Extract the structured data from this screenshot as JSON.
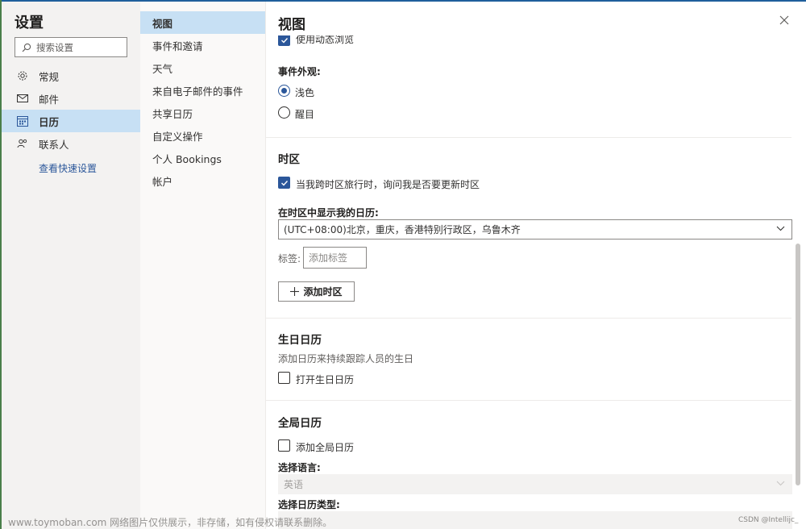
{
  "sidebar": {
    "title": "设置",
    "search_placeholder": "搜索设置",
    "items": [
      {
        "label": "常规",
        "icon": "gear-icon"
      },
      {
        "label": "邮件",
        "icon": "mail-icon"
      },
      {
        "label": "日历",
        "icon": "calendar-icon",
        "active": true
      },
      {
        "label": "联系人",
        "icon": "people-icon"
      }
    ],
    "quick_settings_link": "查看快速设置"
  },
  "subnav": {
    "items": [
      {
        "label": "视图",
        "active": true
      },
      {
        "label": "事件和邀请"
      },
      {
        "label": "天气"
      },
      {
        "label": "来自电子邮件的事件"
      },
      {
        "label": "共享日历"
      },
      {
        "label": "自定义操作"
      },
      {
        "label": "个人 Bookings"
      },
      {
        "label": "帐户"
      }
    ]
  },
  "pane": {
    "title": "视图",
    "dynamic_preview_label": "使用动态浏览",
    "event_appearance": {
      "label": "事件外观:",
      "options": [
        {
          "label": "浅色",
          "selected": true
        },
        {
          "label": "醒目",
          "selected": false
        }
      ]
    },
    "timezone": {
      "title": "时区",
      "ask_update_label": "当我跨时区旅行时，询问我是否要更新时区",
      "ask_update_checked": true,
      "display_label": "在时区中显示我的日历:",
      "selected_timezone": "(UTC+08:00)北京，重庆，香港特别行政区，乌鲁木齐",
      "tag_label": "标签:",
      "tag_placeholder": "添加标签",
      "add_button": "添加时区"
    },
    "birthday": {
      "title": "生日日历",
      "description": "添加日历来持续跟踪人员的生日",
      "toggle_label": "打开生日日历",
      "checked": false
    },
    "global": {
      "title": "全局日历",
      "toggle_label": "添加全局日历",
      "checked": false,
      "language_label": "选择语言:",
      "language_value": "英语",
      "type_label": "选择日历类型:"
    }
  },
  "watermark": "www.toymoban.com 网络图片仅供展示，非存储，如有侵权请联系删除。",
  "credit": "CSDN @Intellijc_",
  "colors": {
    "accent": "#2b579a",
    "selected_bg": "#c7e0f4"
  }
}
